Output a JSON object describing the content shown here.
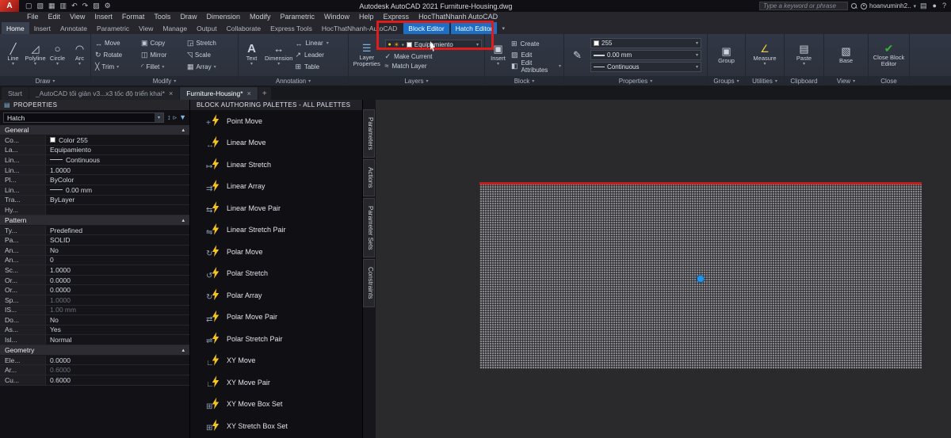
{
  "colors": {
    "accent_red": "#dd1c1c",
    "contextual_tab_blue": "#1c6fc4",
    "grip_blue": "#2196e8",
    "hatch_red_edge": "#c21d1d",
    "bolt_yellow": "#f6c51d"
  },
  "titlebar": {
    "app_title": "Autodesk AutoCAD 2021    Furniture-Housing.dwg",
    "search_placeholder": "Type a keyword or phrase",
    "user_label": "hoanvuminh2..",
    "qat_icons": [
      {
        "name": "new-file-icon",
        "glyph": "▢"
      },
      {
        "name": "open-file-icon",
        "glyph": "▧"
      },
      {
        "name": "save-icon",
        "glyph": "▦"
      },
      {
        "name": "print-icon",
        "glyph": "▥"
      },
      {
        "name": "undo-icon",
        "glyph": "↶"
      },
      {
        "name": "redo-icon",
        "glyph": "↷"
      },
      {
        "name": "plot-icon",
        "glyph": "▨"
      },
      {
        "name": "workspace-icon",
        "glyph": "⚙"
      }
    ],
    "right_icons": [
      {
        "name": "cart-icon",
        "glyph": "▤"
      },
      {
        "name": "bell-icon",
        "glyph": "●"
      },
      {
        "name": "help-icon",
        "glyph": "?"
      }
    ]
  },
  "menu": {
    "items": [
      "File",
      "Edit",
      "View",
      "Insert",
      "Format",
      "Tools",
      "Draw",
      "Dimension",
      "Modify",
      "Parametric",
      "Window",
      "Help",
      "Express",
      "HocThatNhanh AutoCAD"
    ]
  },
  "ribbon_tabs": {
    "items": [
      "Home",
      "Insert",
      "Annotate",
      "Parametric",
      "View",
      "Manage",
      "Output",
      "Collaborate",
      "Express Tools",
      "HocThatNhanh-AutoCAD"
    ],
    "active": "Home",
    "contextual": [
      "Block Editor",
      "Hatch Editor"
    ]
  },
  "ribbon": {
    "draw": {
      "label": "Draw",
      "bigs": [
        {
          "name": "line-button",
          "label": "Line",
          "glyph": "╱"
        },
        {
          "name": "polyline-button",
          "label": "Polyline",
          "glyph": "◿"
        },
        {
          "name": "circle-button",
          "label": "Circle",
          "glyph": "○"
        },
        {
          "name": "arc-button",
          "label": "Arc",
          "glyph": "◠"
        }
      ],
      "small_icons": [
        {
          "name": "rectangle-icon",
          "glyph": "▭"
        },
        {
          "name": "hatch-icon",
          "glyph": "▦"
        },
        {
          "name": "more-draw-icon-1",
          "glyph": "▾"
        },
        {
          "name": "ellipse-icon",
          "glyph": "○"
        },
        {
          "name": "revision-cloud-icon",
          "glyph": "☁"
        },
        {
          "name": "more-draw-icon-2",
          "glyph": "▾"
        },
        {
          "name": "region-icon",
          "glyph": "▩"
        },
        {
          "name": "point-icon",
          "glyph": "·"
        },
        {
          "name": "more-draw-icon-3",
          "glyph": "▾"
        }
      ]
    },
    "modify": {
      "label": "Modify",
      "items": [
        {
          "label": "Move",
          "glyph": "↔"
        },
        {
          "label": "Copy",
          "glyph": "▣"
        },
        {
          "label": "Stretch",
          "glyph": "◲"
        },
        {
          "label": "Rotate",
          "glyph": "↻"
        },
        {
          "label": "Mirror",
          "glyph": "◫"
        },
        {
          "label": "Scale",
          "glyph": "◹"
        },
        {
          "label": "Trim",
          "glyph": "╳",
          "caret": true
        },
        {
          "label": "Fillet",
          "glyph": "◜",
          "caret": true
        },
        {
          "label": "Array",
          "glyph": "▦",
          "caret": true
        }
      ]
    },
    "annotation": {
      "label": "Annotation",
      "text": {
        "label": "Text",
        "glyph": "A"
      },
      "dimension": {
        "label": "Dimension",
        "glyph": "↔"
      },
      "rows": [
        {
          "label": "Linear",
          "glyph": "↔",
          "caret": true
        },
        {
          "label": "Leader",
          "glyph": "↗"
        },
        {
          "label": "Table",
          "glyph": "⊞"
        }
      ]
    },
    "layers": {
      "label": "Layers",
      "big": {
        "label": "Layer Properties",
        "glyph": "☰"
      },
      "dropdown_value": "Equipamiento",
      "rows": [
        {
          "label": "Make Current",
          "glyph": "✓"
        },
        {
          "label": "Match Layer",
          "glyph": "≈"
        }
      ]
    },
    "block": {
      "label": "Block",
      "big": {
        "label": "Insert",
        "glyph": "▣"
      },
      "rows": [
        {
          "label": "Create",
          "glyph": "⊞"
        },
        {
          "label": "Edit",
          "glyph": "▨"
        },
        {
          "label": "Edit Attributes",
          "glyph": "◧",
          "caret": true
        }
      ]
    },
    "properties_panel": {
      "label": "Properties",
      "match_label": "Match Properties",
      "match_glyph": "✎",
      "color_value": "255",
      "lineweight_value": "0.00 mm",
      "linetype_value": "Continuous"
    },
    "groups": {
      "label": "Groups",
      "big": {
        "label": "Group",
        "glyph": "▣"
      }
    },
    "utilities": {
      "label": "Utilities",
      "big": {
        "label": "Measure",
        "glyph": "∠"
      }
    },
    "clipboard": {
      "label": "Clipboard",
      "big": {
        "label": "Paste",
        "glyph": "▤"
      }
    },
    "view_panel": {
      "label": "View",
      "big": {
        "label": "Base",
        "glyph": "▧"
      }
    },
    "close_panel": {
      "label": "Close",
      "big": {
        "label": "Close Block Editor",
        "glyph": "✔"
      }
    }
  },
  "doc_tabs": {
    "items": [
      {
        "label": "Start",
        "closable": false,
        "active": false
      },
      {
        "label": "_AutoCAD tối giản v3...x3 tốc độ triển khai*",
        "closable": true,
        "active": false
      },
      {
        "label": "Furniture-Housing*",
        "closable": true,
        "active": true
      }
    ],
    "new_tab_label": "+"
  },
  "properties_palette": {
    "title": "PROPERTIES",
    "selector_value": "Hatch",
    "toolbar_icons": [
      {
        "name": "pickadd-toggle-icon",
        "glyph": "↕"
      },
      {
        "name": "select-objects-icon",
        "glyph": "▹"
      },
      {
        "name": "quick-select-icon",
        "glyph": "▼"
      }
    ],
    "sections": [
      {
        "name": "General",
        "rows": [
          {
            "k": "Co...",
            "v": "Color 255",
            "swatch": true
          },
          {
            "k": "La...",
            "v": "Equipamiento"
          },
          {
            "k": "Lin...",
            "v": "Continuous",
            "line": true
          },
          {
            "k": "Lin...",
            "v": "1.0000"
          },
          {
            "k": "Pl...",
            "v": "ByColor"
          },
          {
            "k": "Lin...",
            "v": "0.00 mm",
            "line": true
          },
          {
            "k": "Tra...",
            "v": "ByLayer"
          },
          {
            "k": "Hy...",
            "v": ""
          }
        ]
      },
      {
        "name": "Pattern",
        "rows": [
          {
            "k": "Ty...",
            "v": "Predefined"
          },
          {
            "k": "Pa...",
            "v": "SOLID"
          },
          {
            "k": "An...",
            "v": "No"
          },
          {
            "k": "An...",
            "v": "0"
          },
          {
            "k": "Sc...",
            "v": "1.0000"
          },
          {
            "k": "Or...",
            "v": "0.0000"
          },
          {
            "k": "Or...",
            "v": "0.0000"
          },
          {
            "k": "Sp...",
            "v": "1.0000",
            "muted": true
          },
          {
            "k": "IS...",
            "v": "1.00 mm",
            "muted": true
          },
          {
            "k": "Do...",
            "v": "No"
          },
          {
            "k": "As...",
            "v": "Yes"
          },
          {
            "k": "Isl...",
            "v": "Normal"
          }
        ]
      },
      {
        "name": "Geometry",
        "rows": [
          {
            "k": "Ele...",
            "v": "0.0000"
          },
          {
            "k": "Ar...",
            "v": "0.6000",
            "muted": true
          },
          {
            "k": "Cu...",
            "v": "0.6000"
          }
        ]
      }
    ]
  },
  "block_palette": {
    "title": "BLOCK AUTHORING PALETTES - ALL PALETTES",
    "items": [
      {
        "label": "Point Move",
        "base": "+"
      },
      {
        "label": "Linear Move",
        "base": "↔"
      },
      {
        "label": "Linear Stretch",
        "base": "↦"
      },
      {
        "label": "Linear Array",
        "base": "⇉"
      },
      {
        "label": "Linear Move Pair",
        "base": "⇆"
      },
      {
        "label": "Linear Stretch Pair",
        "base": "⇋"
      },
      {
        "label": "Polar Move",
        "base": "↻"
      },
      {
        "label": "Polar Stretch",
        "base": "↺"
      },
      {
        "label": "Polar Array",
        "base": "↻"
      },
      {
        "label": "Polar Move Pair",
        "base": "⇄"
      },
      {
        "label": "Polar Stretch Pair",
        "base": "⇌"
      },
      {
        "label": "XY Move",
        "base": "∟"
      },
      {
        "label": "XY Move Pair",
        "base": "∟"
      },
      {
        "label": "XY Move Box Set",
        "base": "⊞"
      },
      {
        "label": "XY Stretch Box Set",
        "base": "⊞"
      }
    ],
    "tabs": [
      "Parameters",
      "Actions",
      "Parameter Sets",
      "Constraints"
    ]
  }
}
